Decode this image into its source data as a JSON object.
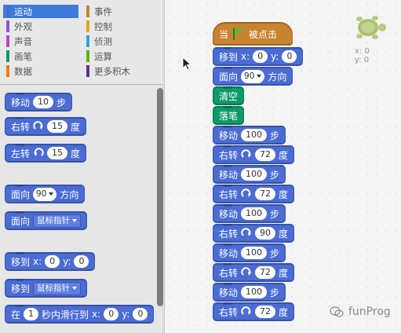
{
  "categories": [
    {
      "label": "运动",
      "color": "#4a6cd4",
      "selected": true
    },
    {
      "label": "外观",
      "color": "#8a55d7"
    },
    {
      "label": "声音",
      "color": "#bb42c3"
    },
    {
      "label": "画笔",
      "color": "#0e9a6c"
    },
    {
      "label": "数据",
      "color": "#ee7d16"
    },
    {
      "label": "事件",
      "color": "#c88330"
    },
    {
      "label": "控制",
      "color": "#e1a91a"
    },
    {
      "label": "侦测",
      "color": "#2ca5e2"
    },
    {
      "label": "运算",
      "color": "#5cb712"
    },
    {
      "label": "更多积木",
      "color": "#632d99"
    }
  ],
  "palette": {
    "move": {
      "label": "移动",
      "value": "10",
      "unit": "步"
    },
    "turn_right": {
      "label": "右转",
      "value": "15",
      "unit": "度"
    },
    "turn_left": {
      "label": "左转",
      "value": "15",
      "unit": "度"
    },
    "point_dir": {
      "label": "面向",
      "value": "90",
      "unit": "方向"
    },
    "point_towards": {
      "label": "面向",
      "option": "鼠标指针"
    },
    "goto_xy": {
      "label": "移到",
      "x_label": "x:",
      "x": "0",
      "y_label": "y:",
      "y": "0"
    },
    "goto_target": {
      "label": "移到",
      "option": "鼠标指针"
    },
    "glide": {
      "label": "在",
      "secs": "1",
      "mid": "秒内滑行到",
      "x_label": "x:",
      "x": "0",
      "y_label": "y:",
      "y": "0"
    }
  },
  "script": {
    "hat": {
      "pre": "当",
      "post": "被点击"
    },
    "goto": {
      "label": "移到",
      "x_label": "x:",
      "x": "0",
      "y_label": "y:",
      "y": "0"
    },
    "point": {
      "label": "面向",
      "value": "90",
      "unit": "方向"
    },
    "clear": "清空",
    "pen_down": "落笔",
    "steps": [
      {
        "label": "移动",
        "value": "100",
        "unit": "步"
      },
      {
        "label": "右转",
        "value": "72",
        "unit": "度"
      },
      {
        "label": "移动",
        "value": "100",
        "unit": "步"
      },
      {
        "label": "右转",
        "value": "72",
        "unit": "度"
      },
      {
        "label": "移动",
        "value": "100",
        "unit": "步"
      },
      {
        "label": "右转",
        "value": "90",
        "unit": "度"
      },
      {
        "label": "移动",
        "value": "100",
        "unit": "步"
      },
      {
        "label": "右转",
        "value": "72",
        "unit": "度"
      },
      {
        "label": "移动",
        "value": "100",
        "unit": "步"
      },
      {
        "label": "右转",
        "value": "72",
        "unit": "度"
      }
    ]
  },
  "sprite_info": {
    "x": "x: 0",
    "y": "y: 0"
  },
  "watermark": "funProg",
  "colors": {
    "motion": "#4a6cd4",
    "pen": "#0e9a6c",
    "events": "#c88330",
    "selected": "#3c7ad9"
  }
}
